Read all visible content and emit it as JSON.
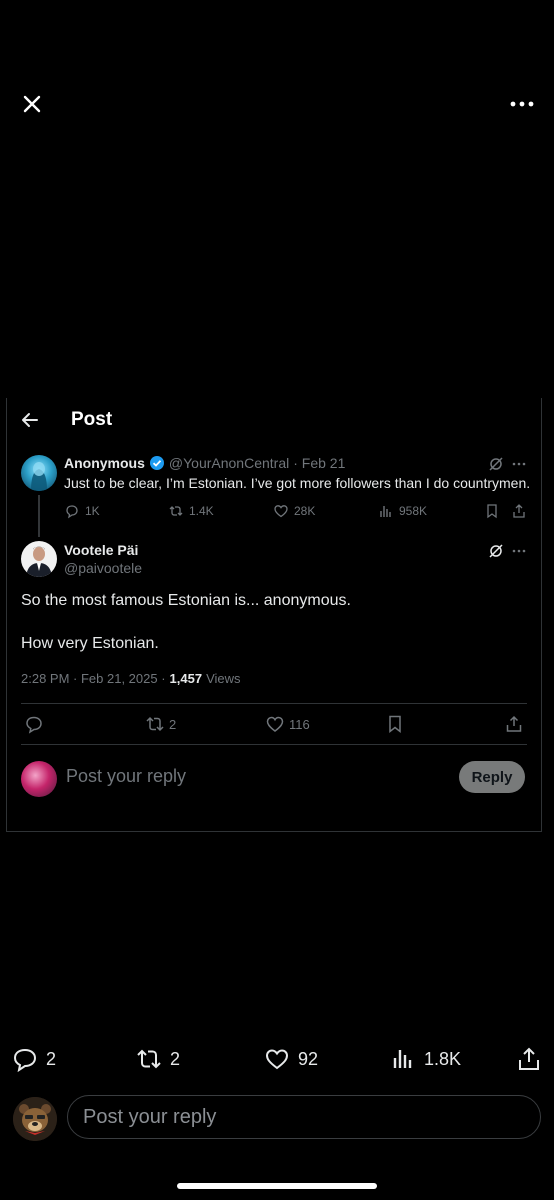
{
  "overlay": {
    "close_icon": "close-icon",
    "more_icon": "more-icon"
  },
  "header": {
    "title": "Post"
  },
  "parent_post": {
    "name": "Anonymous",
    "handle": "@YourAnonCentral",
    "date": "· Feb 21",
    "text": "Just to be clear, I’m Estonian. I’ve got more followers than I do countrymen.",
    "replies": "1K",
    "reposts": "1.4K",
    "likes": "28K",
    "views": "958K"
  },
  "main_post": {
    "name": "Vootele Päi",
    "handle": "@paivootele",
    "text1": "So the most famous Estonian is... anonymous.",
    "text2": "How very Estonian.",
    "timestamp": "2:28 PM · Feb 21, 2025 ·",
    "views_count": "1,457",
    "views_label": "Views",
    "reposts": "2",
    "likes": "116"
  },
  "inner_reply": {
    "placeholder": "Post your reply",
    "button": "Reply"
  },
  "action_bar": {
    "replies": "2",
    "reposts": "2",
    "likes": "92",
    "views": "1.8K"
  },
  "compose": {
    "placeholder": "Post your reply"
  },
  "colors": {
    "background": "#000000",
    "verified": "#1d9bf0",
    "muted": "#71767b"
  }
}
